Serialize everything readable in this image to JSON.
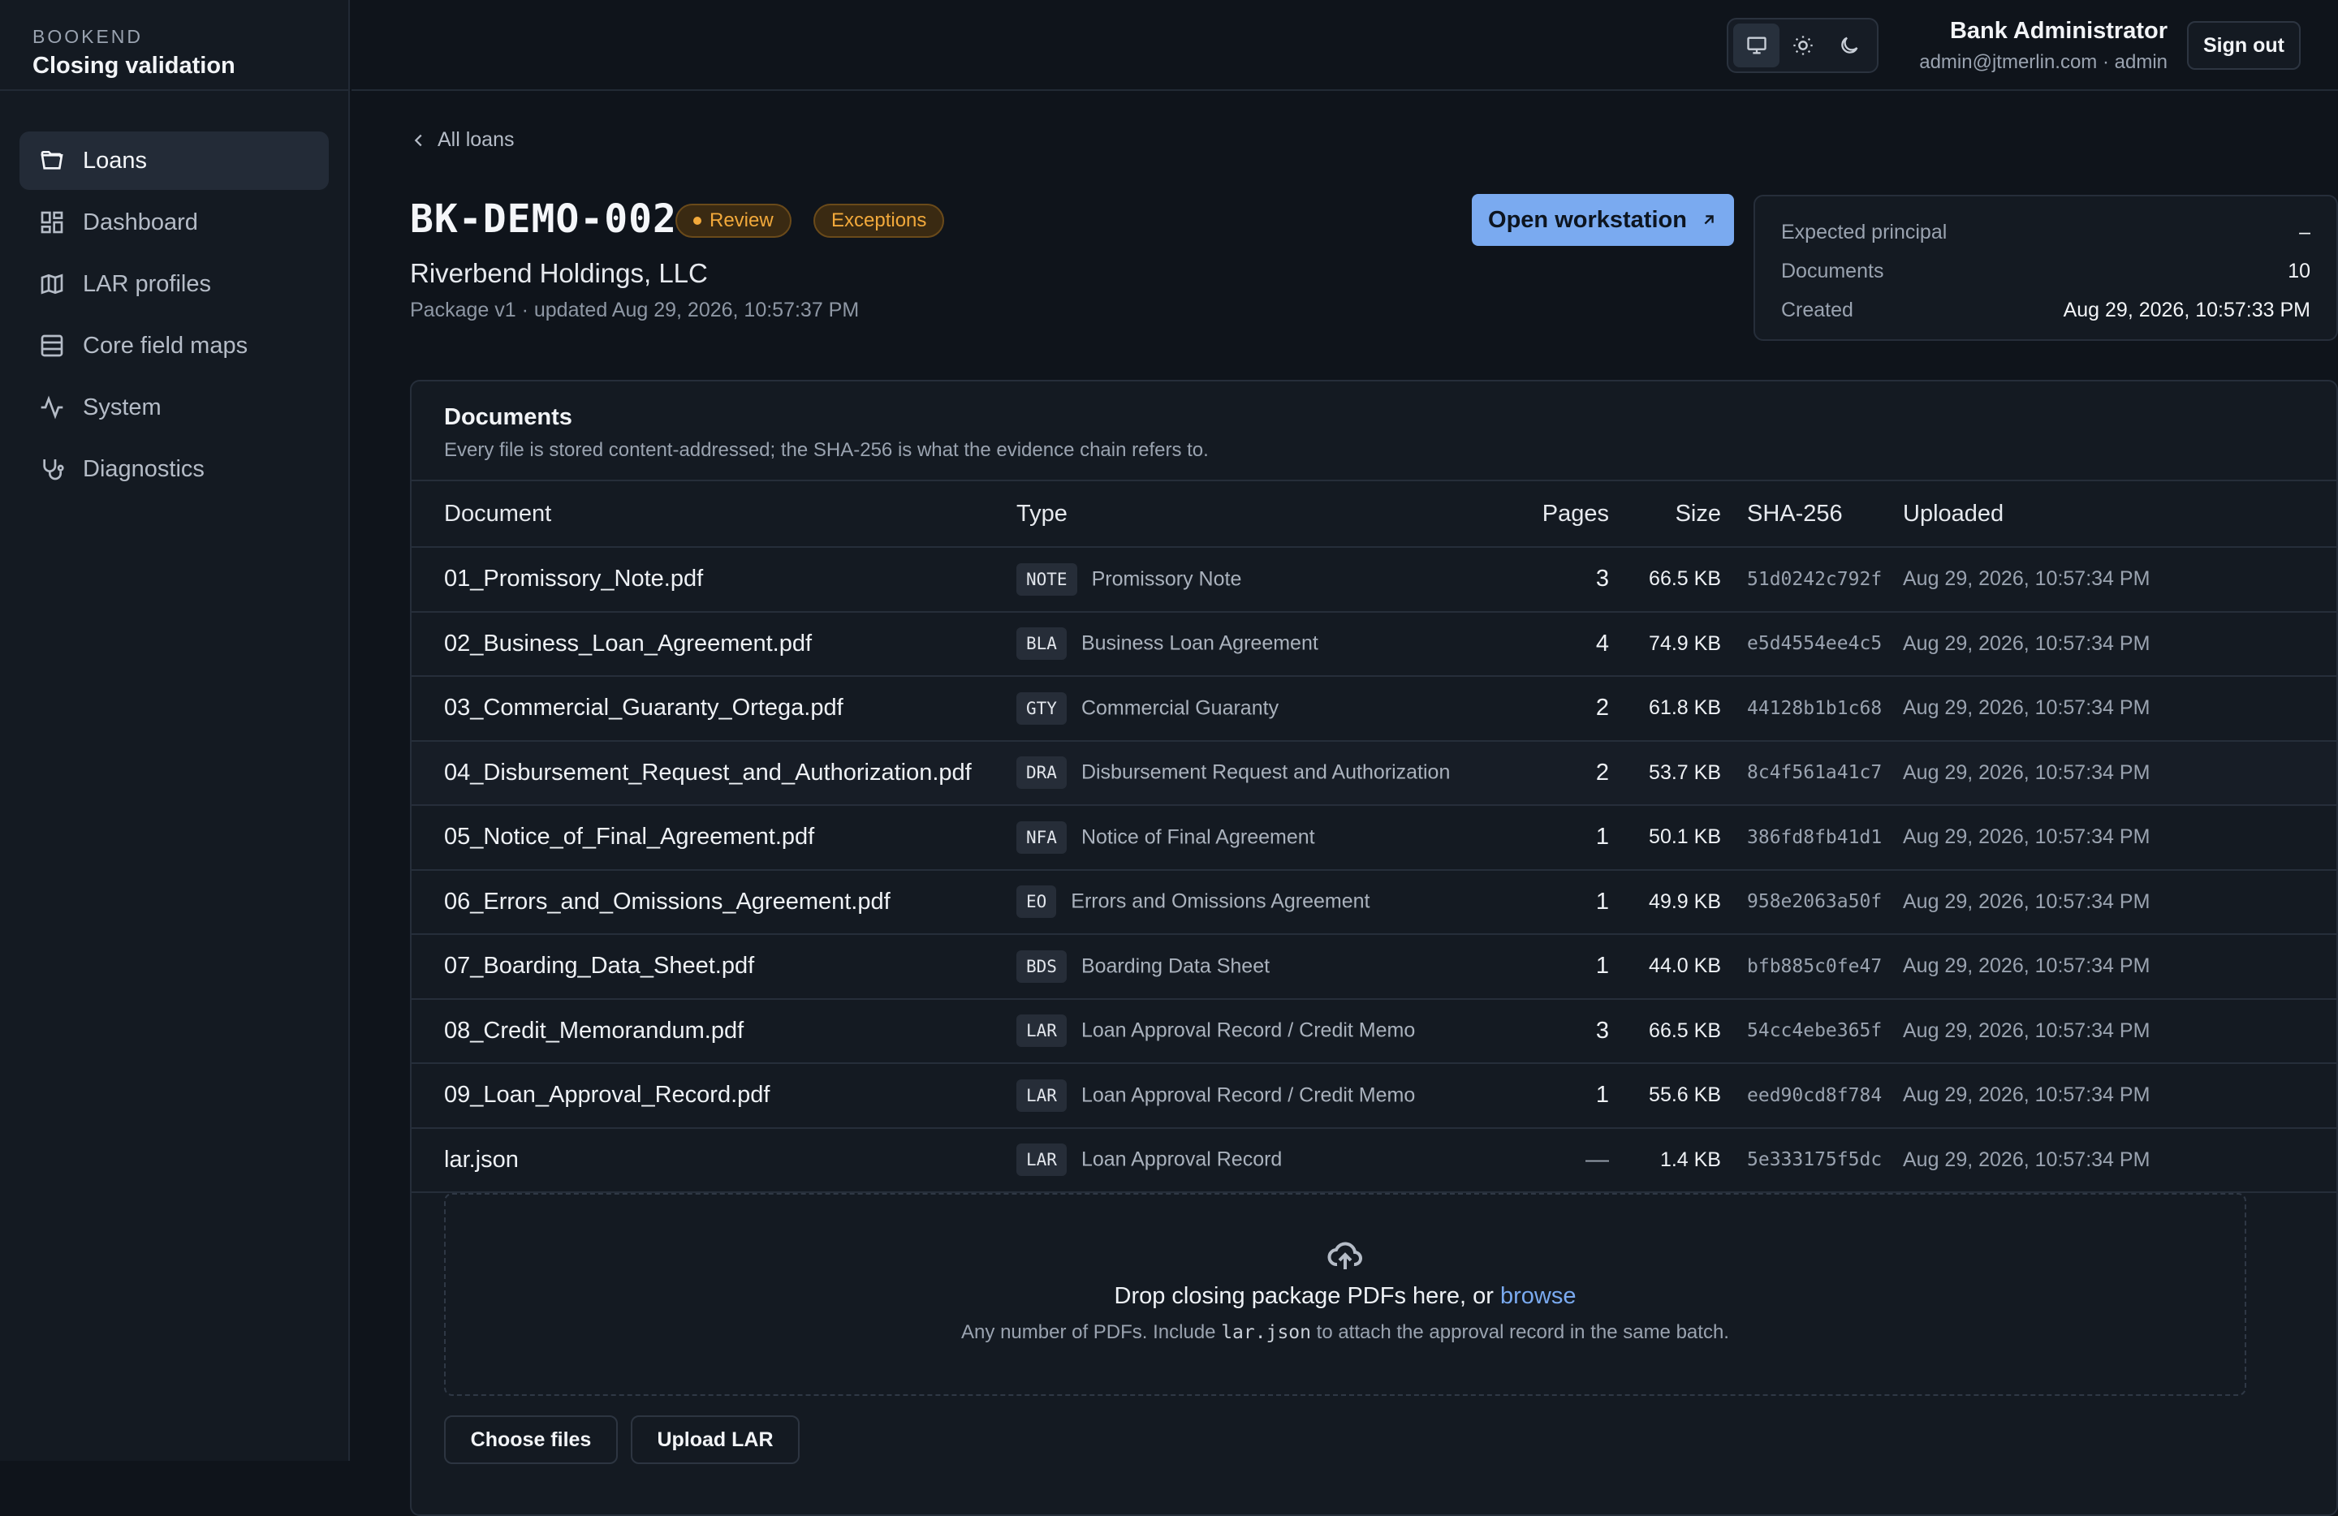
{
  "brand": {
    "eyebrow": "BOOKEND",
    "title": "Closing validation"
  },
  "sidebar": {
    "items": [
      {
        "label": "Loans",
        "icon": "folder-open-icon",
        "active": true
      },
      {
        "label": "Dashboard",
        "icon": "dashboard-grid-icon"
      },
      {
        "label": "LAR profiles",
        "icon": "map-icon"
      },
      {
        "label": "Core field maps",
        "icon": "table-icon"
      },
      {
        "label": "System",
        "icon": "activity-icon"
      },
      {
        "label": "Diagnostics",
        "icon": "stethoscope-icon"
      }
    ]
  },
  "header": {
    "user_name": "Bank Administrator",
    "user_email": "admin@jtmerlin.com · admin",
    "sign_out": "Sign out",
    "theme_options": [
      "monitor-icon",
      "sun-icon",
      "moon-icon"
    ]
  },
  "page": {
    "back_label": "All loans",
    "loan_id": "BK-DEMO-002",
    "status_badge": "Review",
    "exceptions_badge": "Exceptions",
    "borrower": "Riverbend Holdings, LLC",
    "package_meta": "Package v1 · updated Aug 29, 2026, 10:57:37 PM",
    "open_workstation": "Open workstation",
    "accent_color": "#7aaaf0",
    "warning_color": "#f2a93b"
  },
  "summary": {
    "expected_principal_label": "Expected principal",
    "expected_principal_value": "–",
    "documents_label": "Documents",
    "documents_value": "10",
    "created_label": "Created",
    "created_value": "Aug 29, 2026, 10:57:33 PM"
  },
  "documents": {
    "title": "Documents",
    "subtitle": "Every file is stored content-addressed; the SHA-256 is what the evidence chain refers to.",
    "columns": [
      "Document",
      "Type",
      "Pages",
      "Size",
      "SHA-256",
      "Uploaded"
    ],
    "rows": [
      {
        "name": "01_Promissory_Note.pdf",
        "code": "NOTE",
        "type": "Promissory Note",
        "pages": "3",
        "size": "66.5 KB",
        "sha": "51d0242c792f",
        "uploaded": "Aug 29, 2026, 10:57:34 PM"
      },
      {
        "name": "02_Business_Loan_Agreement.pdf",
        "code": "BLA",
        "type": "Business Loan Agreement",
        "pages": "4",
        "size": "74.9 KB",
        "sha": "e5d4554ee4c5",
        "uploaded": "Aug 29, 2026, 10:57:34 PM"
      },
      {
        "name": "03_Commercial_Guaranty_Ortega.pdf",
        "code": "GTY",
        "type": "Commercial Guaranty",
        "pages": "2",
        "size": "61.8 KB",
        "sha": "44128b1b1c68",
        "uploaded": "Aug 29, 2026, 10:57:34 PM"
      },
      {
        "name": "04_Disbursement_Request_and_Authorization.pdf",
        "code": "DRA",
        "type": "Disbursement Request and Authorization",
        "pages": "2",
        "size": "53.7 KB",
        "sha": "8c4f561a41c7",
        "uploaded": "Aug 29, 2026, 10:57:34 PM"
      },
      {
        "name": "05_Notice_of_Final_Agreement.pdf",
        "code": "NFA",
        "type": "Notice of Final Agreement",
        "pages": "1",
        "size": "50.1 KB",
        "sha": "386fd8fb41d1",
        "uploaded": "Aug 29, 2026, 10:57:34 PM"
      },
      {
        "name": "06_Errors_and_Omissions_Agreement.pdf",
        "code": "EO",
        "type": "Errors and Omissions Agreement",
        "pages": "1",
        "size": "49.9 KB",
        "sha": "958e2063a50f",
        "uploaded": "Aug 29, 2026, 10:57:34 PM"
      },
      {
        "name": "07_Boarding_Data_Sheet.pdf",
        "code": "BDS",
        "type": "Boarding Data Sheet",
        "pages": "1",
        "size": "44.0 KB",
        "sha": "bfb885c0fe47",
        "uploaded": "Aug 29, 2026, 10:57:34 PM"
      },
      {
        "name": "08_Credit_Memorandum.pdf",
        "code": "LAR",
        "type": "Loan Approval Record / Credit Memo",
        "pages": "3",
        "size": "66.5 KB",
        "sha": "54cc4ebe365f",
        "uploaded": "Aug 29, 2026, 10:57:34 PM"
      },
      {
        "name": "09_Loan_Approval_Record.pdf",
        "code": "LAR",
        "type": "Loan Approval Record / Credit Memo",
        "pages": "1",
        "size": "55.6 KB",
        "sha": "eed90cd8f784",
        "uploaded": "Aug 29, 2026, 10:57:34 PM"
      },
      {
        "name": "lar.json",
        "code": "LAR",
        "type": "Loan Approval Record",
        "pages": "—",
        "size": "1.4 KB",
        "sha": "5e333175f5dc",
        "uploaded": "Aug 29, 2026, 10:57:34 PM"
      }
    ]
  },
  "dropzone": {
    "line1_prefix": "Drop closing package PDFs here, or ",
    "browse": "browse",
    "line2_prefix": "Any number of PDFs. Include ",
    "line2_code": "lar.json",
    "line2_suffix": " to attach the approval record in the same batch."
  },
  "actions": {
    "choose_files": "Choose files",
    "upload_lar": "Upload LAR"
  }
}
